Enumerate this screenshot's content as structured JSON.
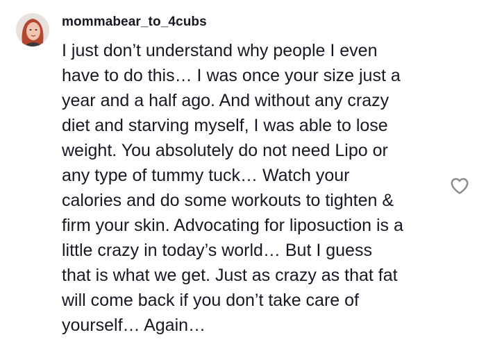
{
  "comment": {
    "username": "mommabear_to_4cubs",
    "avatar_icon": "user-avatar-photo",
    "text_lines": [
      "I just don’t understand why people I even",
      "have to do this… I was once your size just a",
      "year and a half ago. And without any crazy",
      "diet and starving myself, I was able to lose",
      "weight. You absolutely do not need Lipo or",
      "any type of tummy tuck… Watch your",
      "calories and do some workouts to tighten &",
      "firm your skin. Advocating for liposuction is a",
      "little crazy in today’s world… But I guess",
      "that is what we get. Just as crazy as that fat",
      "will come back if you don’t take care of",
      "yourself… Again…"
    ],
    "like_icon": "heart-outline-icon"
  },
  "colors": {
    "text": "#161823",
    "icon_stroke": "#8a8b91",
    "background": "#ffffff"
  }
}
